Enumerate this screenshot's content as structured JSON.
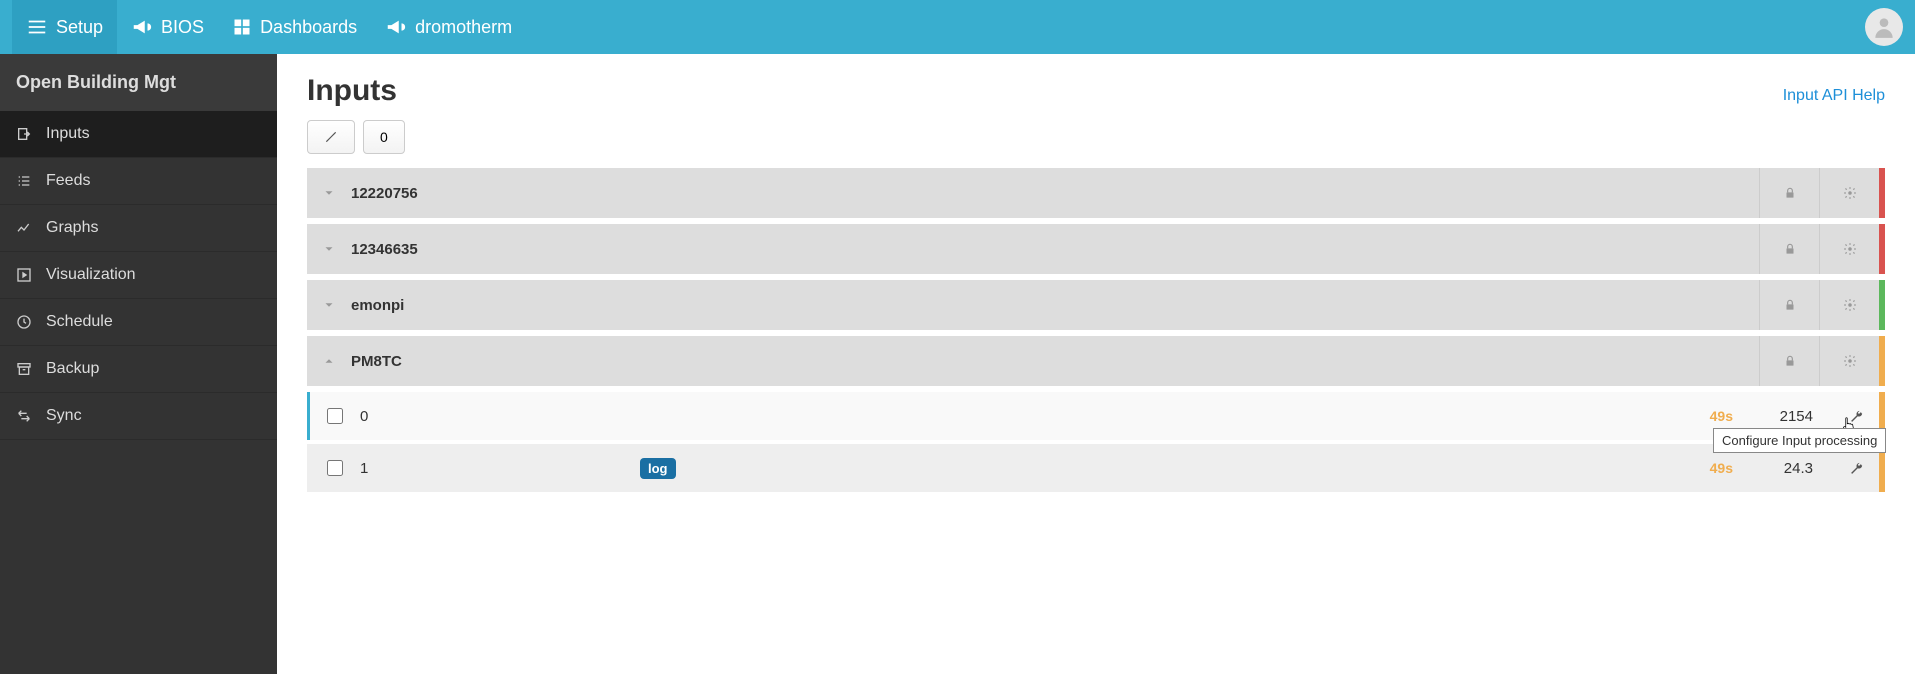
{
  "topbar": {
    "setup": "Setup",
    "bios": "BIOS",
    "dashboards": "Dashboards",
    "dromotherm": "dromotherm"
  },
  "sidebar": {
    "title": "Open Building Mgt",
    "items": [
      {
        "label": "Inputs"
      },
      {
        "label": "Feeds"
      },
      {
        "label": "Graphs"
      },
      {
        "label": "Visualization"
      },
      {
        "label": "Schedule"
      },
      {
        "label": "Backup"
      },
      {
        "label": "Sync"
      }
    ]
  },
  "page": {
    "title": "Inputs",
    "api_link": "Input API Help",
    "toolbar_count": "0"
  },
  "groups": [
    {
      "name": "12220756",
      "expanded": false,
      "status": "red"
    },
    {
      "name": "12346635",
      "expanded": false,
      "status": "red"
    },
    {
      "name": "emonpi",
      "expanded": false,
      "status": "green"
    },
    {
      "name": "PM8TC",
      "expanded": true,
      "status": "orange"
    }
  ],
  "inputs": [
    {
      "name": "0",
      "tag": "",
      "time": "49s",
      "value": "2154",
      "stripe": "orange",
      "selected": true
    },
    {
      "name": "1",
      "tag": "log",
      "time": "49s",
      "value": "24.3",
      "stripe": "orange",
      "selected": false
    }
  ],
  "tooltip": "Configure Input processing"
}
